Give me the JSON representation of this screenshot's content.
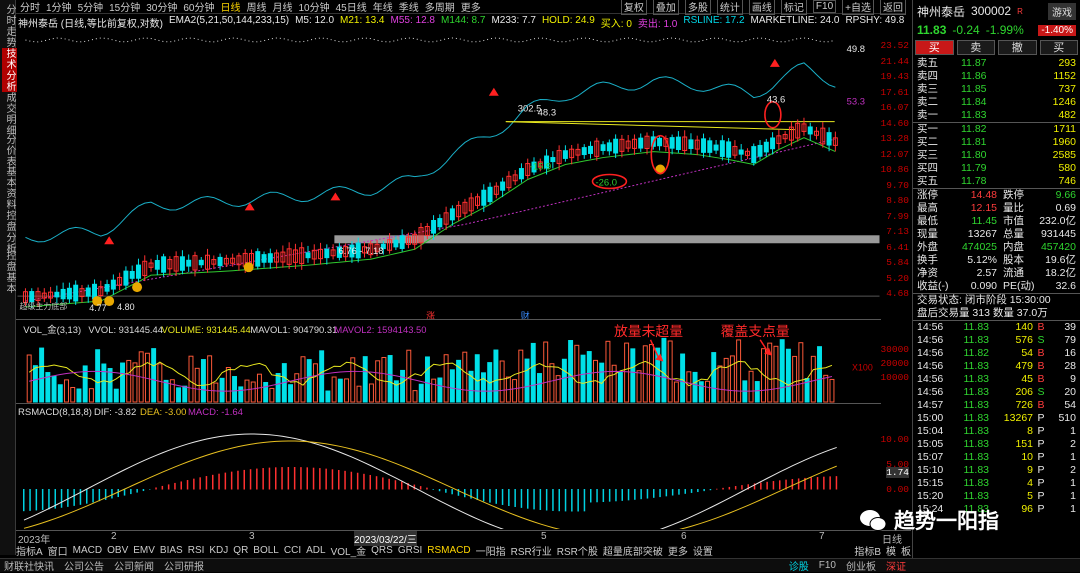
{
  "left_tabs": [
    "分时走势",
    "技术分析",
    "成交明细",
    "分价表",
    "基本资料",
    "控盘分析",
    "控盘基本"
  ],
  "topbar": {
    "periods": [
      "分时",
      "1分钟",
      "5分钟",
      "15分钟",
      "30分钟",
      "60分钟",
      "日线",
      "周线",
      "月线",
      "10分钟",
      "45日线",
      "年线",
      "季线",
      "多周期",
      "更多"
    ],
    "selected": "日线",
    "right": [
      "复权",
      "叠加",
      "多股",
      "统计",
      "画线",
      "标记",
      "F10",
      "+自选",
      "返回"
    ]
  },
  "info": {
    "title": "神州泰岳 (日线,等比前复权,对数)",
    "ema": "EMA2(5,21,50,144,233,15)",
    "m5": "M5: 12.0",
    "m21": "M21: 13.4",
    "m55": "M55: 12.8",
    "m144": "M144: 8.7",
    "m233": "M233: 7.7",
    "hold": "HOLD: 24.9",
    "buy": "买入: 0",
    "sell": "卖出: 1.0",
    "rsline": "RSLINE: 17.2",
    "market": "MARKETLINE: 24.0",
    "rpshy": "RPSHY: 49.8"
  },
  "chart_labels": {
    "a1": "302.5",
    "a2": "48.3",
    "a3": "-15.9",
    "a4": "-26.0",
    "a5": "43.6",
    "a6": "53.3",
    "a7": "49.8",
    "a8": "6.76 - 7.18",
    "a9": "4.77",
    "a10": "4.80",
    "a11": "超级主力底部",
    "mk1": "涨",
    "mk2": "财"
  },
  "y_ticks": [
    "23.52",
    "21.44",
    "19.43",
    "17.61",
    "16.07",
    "14.60",
    "13.28",
    "12.07",
    "10.86",
    "9.70",
    "8.80",
    "7.99",
    "7.13",
    "6.41",
    "5.84",
    "5.20",
    "4.68"
  ],
  "vol": {
    "title": "VOL_金(3,13)",
    "vvol": "VVOL: 931445.44",
    "volume": "VOLUME: 931445.44",
    "mavol1": "MAVOL1: 904790.31",
    "mavol2": "MAVOL2: 1594143.50",
    "ticks": [
      "30000",
      "20000",
      "10000"
    ],
    "unit": "X100",
    "annot1": "放量未超量",
    "annot2": "覆盖支点量"
  },
  "macd": {
    "title": "RSMACD(8,18,8)",
    "dif": "DIF: -3.82",
    "dea": "DEA: -3.00",
    "macd": "MACD: -1.64",
    "ticks": [
      "10.00",
      "5.00",
      "0.00"
    ],
    "last": "1.74"
  },
  "xaxis": {
    "labels": [
      "2023年",
      "2",
      "3",
      "2023/03/22/三",
      "5",
      "6",
      "7"
    ],
    "right": "日线"
  },
  "bottom_tabs": [
    "指标A",
    "窗口",
    "MACD",
    "OBV",
    "EMV",
    "BIAS",
    "RSI",
    "KDJ",
    "QR",
    "BOLL",
    "CCI",
    "ADL",
    "VOL_金",
    "QRS",
    "GRSI",
    "RSMACD",
    "一阳指",
    "RSR行业",
    "RSR个股",
    "超量底部突破",
    "更多",
    "设置"
  ],
  "bottom_selected": "RSMACD",
  "bottom_right": [
    "指标B",
    "模",
    "板"
  ],
  "footer": {
    "items": [
      "财联社快讯",
      "公司公告",
      "公司新闻",
      "公司研报"
    ],
    "right": [
      "诊股",
      "F10",
      "创业板",
      "深证"
    ]
  },
  "quote": {
    "name": "神州泰岳",
    "code": "300002",
    "tag": "R",
    "tabs": [
      "游戏"
    ],
    "price": "11.83",
    "chg": "-0.24",
    "pct": "-1.99%",
    "change_badge": "-1.40%",
    "buy_btn": "买",
    "sell_btn": "卖",
    "cancel_btn": "撤",
    "other_btn": "买",
    "asks": [
      [
        "卖五",
        "11.87",
        "293"
      ],
      [
        "卖四",
        "11.86",
        "1152"
      ],
      [
        "卖三",
        "11.85",
        "737"
      ],
      [
        "卖二",
        "11.84",
        "1246"
      ],
      [
        "卖一",
        "11.83",
        "482"
      ]
    ],
    "bids": [
      [
        "买一",
        "11.82",
        "1711"
      ],
      [
        "买二",
        "11.81",
        "1960"
      ],
      [
        "买三",
        "11.80",
        "2585"
      ],
      [
        "买四",
        "11.79",
        "580"
      ],
      [
        "买五",
        "11.78",
        "746"
      ]
    ],
    "stats": [
      [
        "涨停",
        "14.48",
        "跌停",
        "9.66"
      ],
      [
        "最高",
        "12.15",
        "量比",
        "0.69"
      ],
      [
        "最低",
        "11.45",
        "市值",
        "232.0亿"
      ],
      [
        "现量",
        "13267",
        "总量",
        "931445"
      ],
      [
        "外盘",
        "474025",
        "内盘",
        "457420"
      ],
      [
        "换手",
        "5.12%",
        "股本",
        "19.6亿"
      ],
      [
        "净资",
        "2.57",
        "流通",
        "18.2亿"
      ],
      [
        "收益(-)",
        "0.090",
        "PE(动)",
        "32.6"
      ]
    ],
    "status": "交易状态: 闭市阶段 15:30:00",
    "after": "盘后交易量 313 数量 37.0万",
    "ticks": [
      [
        "14:56",
        "11.83",
        "140",
        "B",
        "39"
      ],
      [
        "14:56",
        "11.83",
        "576",
        "S",
        "79"
      ],
      [
        "14:56",
        "11.82",
        "54",
        "B",
        "16"
      ],
      [
        "14:56",
        "11.83",
        "479",
        "B",
        "28"
      ],
      [
        "14:56",
        "11.83",
        "45",
        "B",
        "9"
      ],
      [
        "14:56",
        "11.83",
        "206",
        "S",
        "20"
      ],
      [
        "14:57",
        "11.83",
        "726",
        "B",
        "54"
      ],
      [
        "15:00",
        "11.83",
        "13267",
        "P",
        "510"
      ],
      [
        "15:04",
        "11.83",
        "8",
        "P",
        "1"
      ],
      [
        "15:05",
        "11.83",
        "151",
        "P",
        "2"
      ],
      [
        "15:07",
        "11.83",
        "10",
        "P",
        "1"
      ],
      [
        "15:10",
        "11.83",
        "9",
        "P",
        "2"
      ],
      [
        "15:15",
        "11.83",
        "4",
        "P",
        "1"
      ],
      [
        "15:20",
        "11.83",
        "5",
        "P",
        "1"
      ],
      [
        "15:24",
        "11.83",
        "96",
        "P",
        "1"
      ]
    ]
  },
  "watermark": "趋势一阳指"
}
